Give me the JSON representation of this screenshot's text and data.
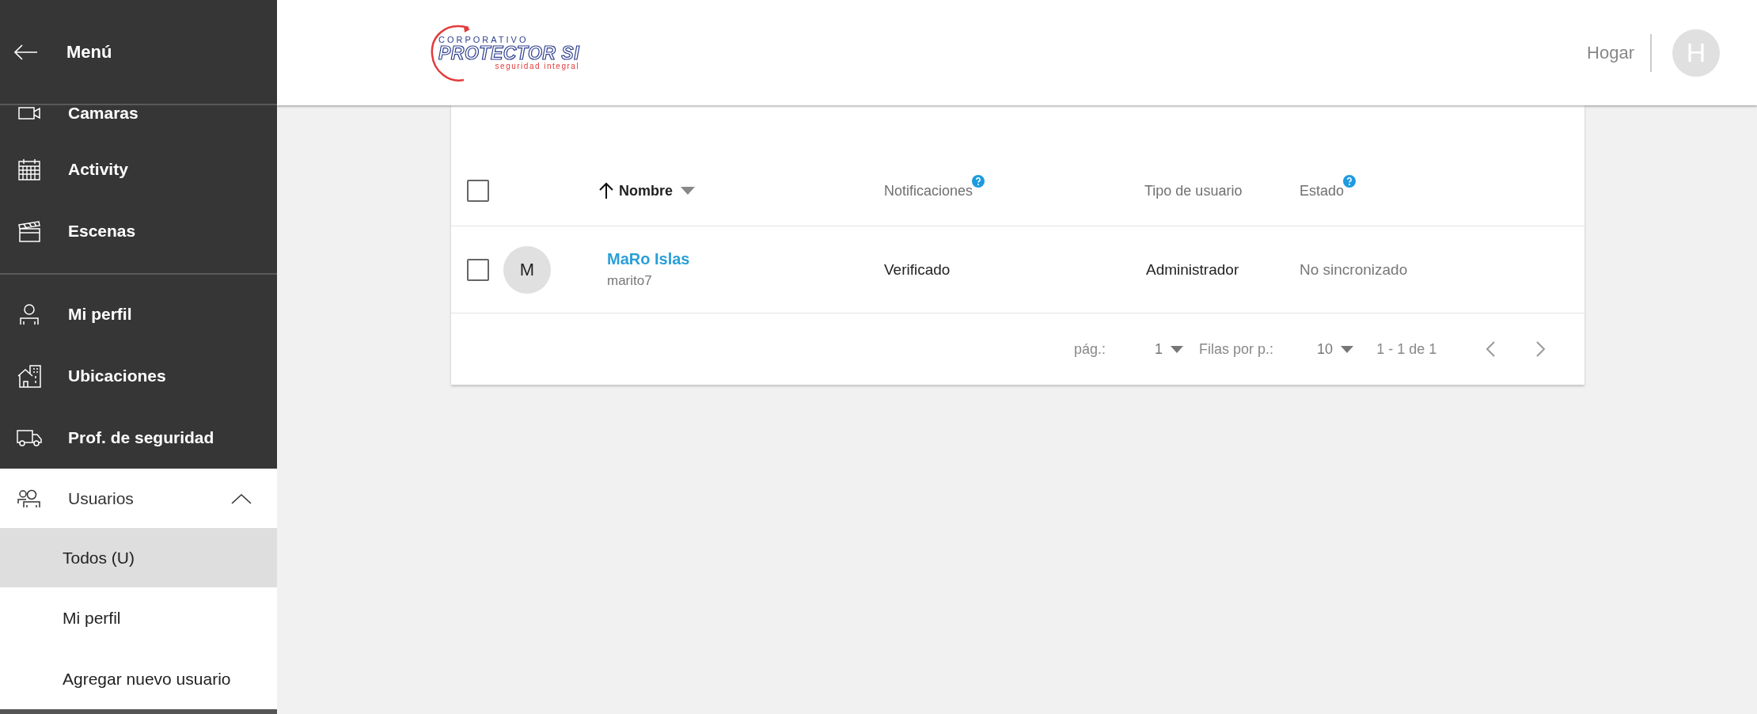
{
  "sidebar": {
    "title": "Menú",
    "sections": [
      {
        "items": [
          {
            "label": "Camaras"
          },
          {
            "label": "Activity"
          },
          {
            "label": "Escenas"
          }
        ]
      },
      {
        "items": [
          {
            "label": "Mi perfil"
          },
          {
            "label": "Ubicaciones"
          },
          {
            "label": "Prof. de seguridad"
          },
          {
            "label": "Usuarios",
            "expanded": true,
            "children": [
              {
                "label": "Todos (U)",
                "selected": true
              },
              {
                "label": "Mi perfil",
                "selected": false
              },
              {
                "label": "Agregar nuevo usuario",
                "selected": false
              }
            ]
          }
        ]
      }
    ]
  },
  "header": {
    "logo": {
      "line1": "CORPORATIVO",
      "line2": "PROTECTOR SI",
      "line3": "seguridad integral"
    },
    "home_link": "Hogar",
    "avatar": "H"
  },
  "table": {
    "select_all": {
      "checked": false
    },
    "columns": [
      {
        "label": "Nombre",
        "sorted": true,
        "help": false
      },
      {
        "label": "Notificaciones",
        "sorted": false,
        "help": true
      },
      {
        "label": "Tipo de usuario",
        "sorted": false,
        "help": false
      },
      {
        "label": "Estado",
        "sorted": false,
        "help": true
      }
    ],
    "rows": [
      {
        "checked": false,
        "avatar": "M",
        "name": "MaRo Islas",
        "username": "marito7",
        "notificaciones": "Verificado",
        "tipo": "Administrador",
        "estado": "No sincronizado"
      }
    ],
    "pagination": {
      "page_label": "pág.:",
      "page": "1",
      "rows_label": "Filas por p.:",
      "rows_per_page": "10",
      "range": "1 - 1 de 1"
    }
  }
}
